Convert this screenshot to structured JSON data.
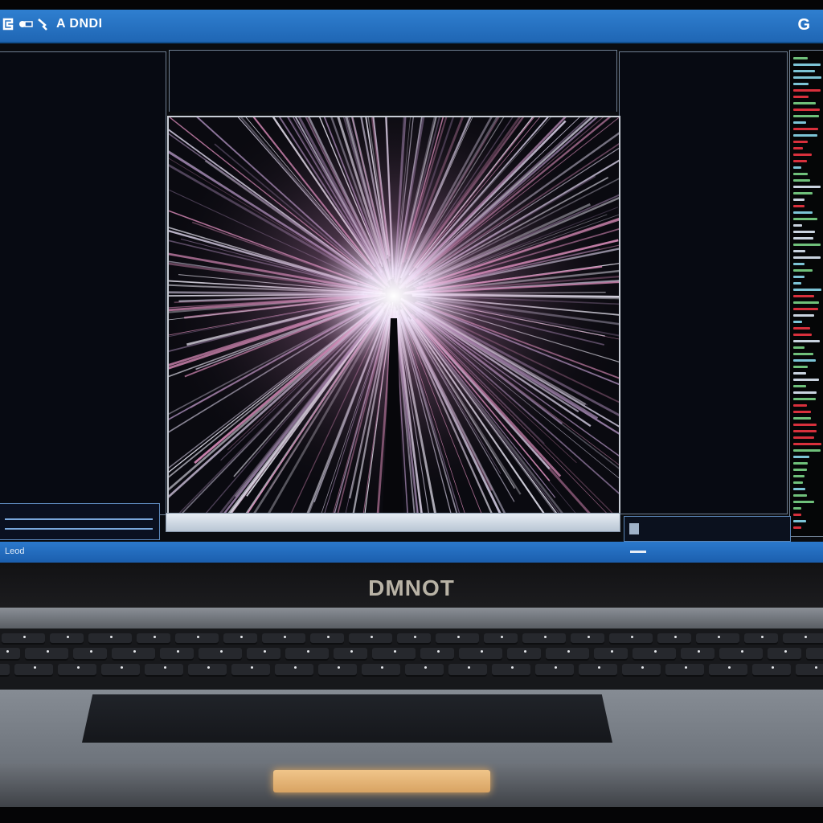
{
  "window": {
    "title": "A DNDI",
    "right_glyph": "G"
  },
  "taskbar": {
    "start_label": "Leod"
  },
  "laptop": {
    "brand": "DMNOT"
  },
  "colors": {
    "titlebar": "#2f7fd0",
    "viewport_glow": "#f7e9ff",
    "streak_pink": "#d88bb8",
    "streak_white": "#e8e6f2",
    "log_red": "#d8303c",
    "log_green": "#6fc07a",
    "log_cyan": "#7cc4d6"
  },
  "icons": {
    "app": "app-logo-icon",
    "tool_a": "connect-icon",
    "tool_b": "pin-icon",
    "right": "google-icon"
  }
}
